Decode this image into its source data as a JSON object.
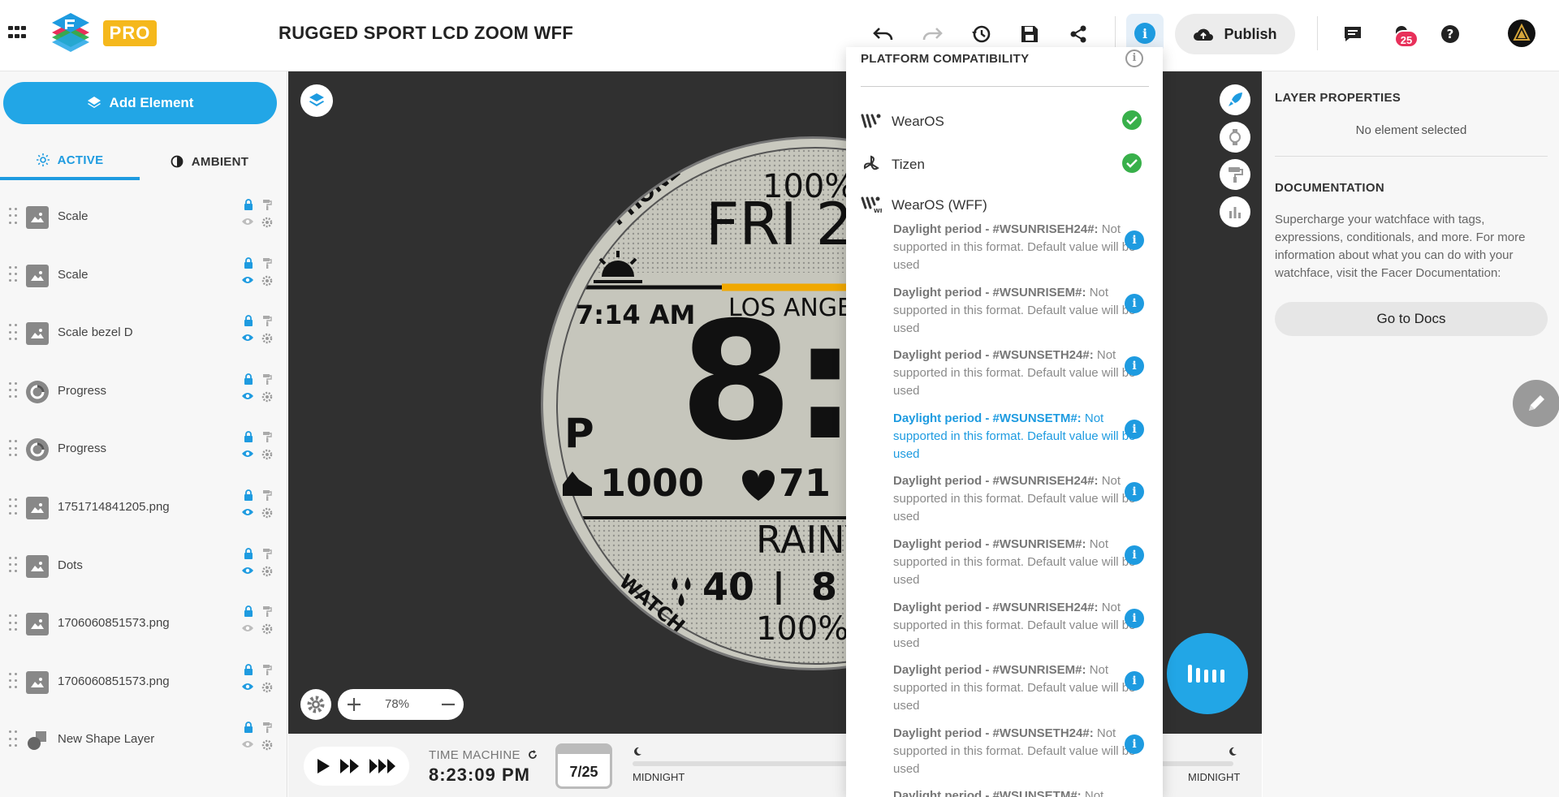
{
  "app": {
    "pro_label": "PRO",
    "document_title": "RUGGED SPORT LCD ZOOM WFF"
  },
  "toolbar": {
    "publish_label": "Publish",
    "notification_count": "25"
  },
  "left_panel": {
    "add_element_label": "Add Element",
    "tab_active": "ACTIVE",
    "tab_ambient": "AMBIENT",
    "layers": [
      {
        "name": "Scale",
        "type": "image"
      },
      {
        "name": "Scale",
        "type": "image"
      },
      {
        "name": "Scale bezel D",
        "type": "image"
      },
      {
        "name": "Progress",
        "type": "progress"
      },
      {
        "name": "Progress",
        "type": "progress"
      },
      {
        "name": "1751714841205.png",
        "type": "image"
      },
      {
        "name": "Dots",
        "type": "image"
      },
      {
        "name": "1706060851573.png",
        "type": "image"
      },
      {
        "name": "1706060851573.png",
        "type": "image"
      },
      {
        "name": "New Shape Layer",
        "type": "shape"
      }
    ]
  },
  "canvas": {
    "zoom_level": "78%",
    "watch": {
      "phone_label": "PHONE",
      "watch_label": "WATCH",
      "top_battery": "100%",
      "day_date": "FRI 2",
      "sunrise_time": "7:14 AM",
      "city": "LOS ANGEL",
      "time_big": "8:2",
      "ampm": "P",
      "steps": "1000",
      "heart_rate": "71",
      "weather": "RAINY",
      "humidity": "40",
      "humidity_right": "8",
      "bottom_battery": "100%"
    }
  },
  "timeline": {
    "time_machine_label": "TIME MACHINE",
    "time_value": "8:23:09 PM",
    "date_value": "7/25",
    "left_label": "MIDNIGHT",
    "right_label": "MIDNIGHT"
  },
  "compat": {
    "title": "PLATFORM COMPATIBILITY",
    "platforms": [
      {
        "name": "WearOS",
        "status": "ok"
      },
      {
        "name": "Tizen",
        "status": "ok"
      },
      {
        "name": "WearOS (WFF)",
        "status": "warnings"
      }
    ],
    "warnings": [
      {
        "strong": "Daylight period - #WSUNRISEH24#:",
        "rest": " Not supported in this format. Default value will be used"
      },
      {
        "strong": "Daylight period - #WSUNRISEM#:",
        "rest": " Not supported in this format. Default value will be used"
      },
      {
        "strong": "Daylight period - #WSUNSETH24#:",
        "rest": " Not supported in this format. Default value will be used"
      },
      {
        "strong": "Daylight period - #WSUNSETM#:",
        "rest": " Not supported in this format. Default value will be used"
      },
      {
        "strong": "Daylight period - #WSUNRISEH24#:",
        "rest": " Not supported in this format. Default value will be used"
      },
      {
        "strong": "Daylight period - #WSUNRISEM#:",
        "rest": " Not supported in this format. Default value will be used"
      },
      {
        "strong": "Daylight period - #WSUNRISEH24#:",
        "rest": " Not supported in this format. Default value will be used"
      },
      {
        "strong": "Daylight period - #WSUNRISEM#:",
        "rest": " Not supported in this format. Default value will be used"
      },
      {
        "strong": "Daylight period - #WSUNSETH24#:",
        "rest": " Not supported in this format. Default value will be used"
      },
      {
        "strong": "Daylight period - #WSUNSETM#:",
        "rest": " Not"
      }
    ],
    "highlight_color": "#1e9be0",
    "ok_color": "#38b04a"
  },
  "right_panel": {
    "layer_properties_heading": "LAYER PROPERTIES",
    "no_selection": "No element selected",
    "documentation_heading": "DOCUMENTATION",
    "documentation_text": "Supercharge your watchface with tags, expressions, conditionals, and more. For more information about what you can do with your watchface, visit the Facer Documentation:",
    "docs_button": "Go to Docs"
  },
  "colors": {
    "accent": "#22a6e6",
    "pro": "#f5b81c",
    "badge": "#e8305a",
    "watch_progress": "#f0a800"
  }
}
